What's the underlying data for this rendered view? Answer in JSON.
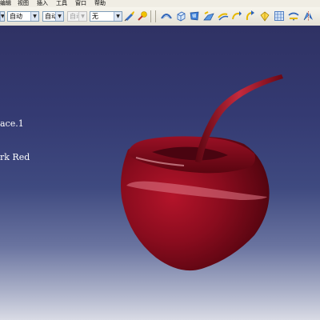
{
  "menu": {
    "items": [
      {
        "label": "编辑"
      },
      {
        "label": "视图"
      },
      {
        "label": "插入"
      },
      {
        "label": "工具"
      },
      {
        "label": "窗口"
      },
      {
        "label": "帮助"
      }
    ]
  },
  "toolbar": {
    "dropdowns": [
      {
        "value": "",
        "enabled": true
      },
      {
        "value": "自动",
        "enabled": true
      },
      {
        "value": "自动",
        "enabled": true
      },
      {
        "value": "自动",
        "enabled": false
      },
      {
        "value": "无",
        "enabled": true
      }
    ],
    "icons": [
      "paint-format-icon",
      "paint-brush-icon",
      "sweep-surface-icon",
      "solid-block-icon",
      "fill-surface-icon",
      "blend-surface-icon",
      "offset-surface-icon",
      "sweep-arrow-icon",
      "rotate-arrow-icon",
      "extract-surface-icon",
      "grid-sketch-icon",
      "unfold-surface-icon",
      "symmetry-icon"
    ]
  },
  "viewport": {
    "labels": [
      {
        "text": "ace.1"
      },
      {
        "text": "rk Red"
      }
    ],
    "colors": {
      "background_top": "#2f3264",
      "background_bottom": "#d9dbe5",
      "cherry": "#7a0a18"
    }
  }
}
